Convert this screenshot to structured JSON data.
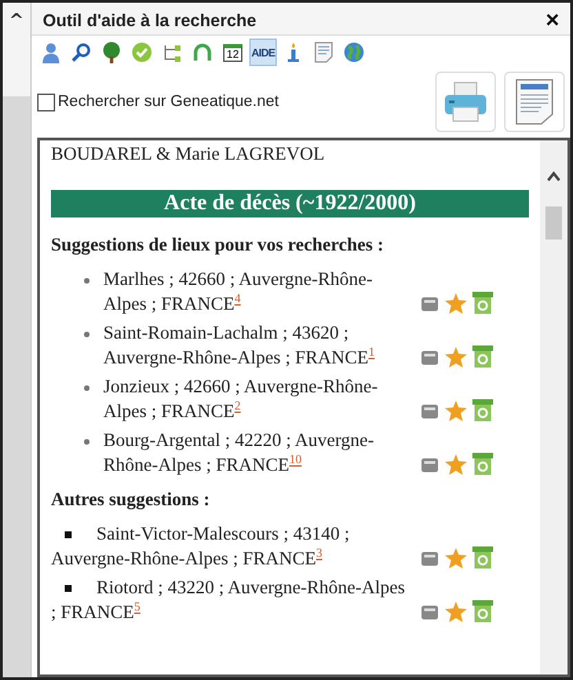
{
  "window": {
    "title": "Outil d'aide à la recherche",
    "close": "×"
  },
  "side_caret": "^",
  "toolbar": [
    {
      "kind": "person",
      "selected": false
    },
    {
      "kind": "search",
      "selected": false
    },
    {
      "kind": "tree",
      "selected": false
    },
    {
      "kind": "check",
      "selected": false
    },
    {
      "kind": "nodes",
      "selected": false
    },
    {
      "kind": "arc",
      "selected": false
    },
    {
      "kind": "calendar",
      "text": "12",
      "selected": false
    },
    {
      "kind": "aide",
      "text": "AIDE",
      "selected": true
    },
    {
      "kind": "candle",
      "selected": false
    },
    {
      "kind": "page",
      "selected": false
    },
    {
      "kind": "globe",
      "selected": false
    }
  ],
  "geneatique": {
    "label": "Rechercher sur Geneatique.net",
    "checked": false
  },
  "content": {
    "names": "BOUDAREL & Marie LAGREVOL",
    "banner": "Acte de décès (~1922/2000)",
    "sections": [
      {
        "heading": "Suggestions de lieux pour vos recherches :",
        "kind": "circle",
        "places": [
          {
            "text": "Marlhes ; 42660 ; Auvergne-Rhône-Alpes ; FRANCE",
            "note": "4"
          },
          {
            "text": "Saint-Romain-Lachalm ; 43620 ; Auvergne-Rhône-Alpes ; FRANCE",
            "note": "1"
          },
          {
            "text": "Jonzieux ; 42660 ; Auvergne-Rhône-Alpes ; FRANCE",
            "note": "2"
          },
          {
            "text": "Bourg-Argental ; 42220 ; Auvergne-Rhône-Alpes ; FRANCE",
            "note": "10"
          }
        ]
      },
      {
        "heading": "Autres suggestions :",
        "kind": "square",
        "places": [
          {
            "text": "Saint-Victor-Malescours ; 43140 ; Auvergne-Rhône-Alpes ; FRANCE",
            "note": "3"
          },
          {
            "text": "Riotord ; 43220 ; Auvergne-Rhône-Alpes ; FRANCE",
            "note": "5"
          }
        ]
      }
    ]
  }
}
